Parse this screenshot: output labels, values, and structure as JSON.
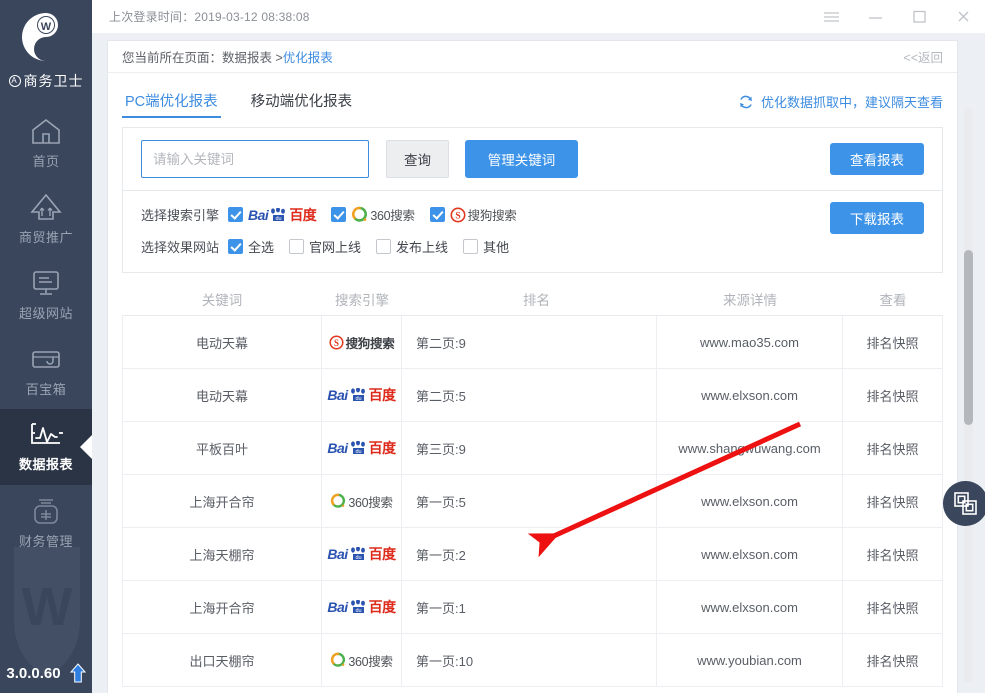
{
  "sidebar": {
    "brand": "商务卫士",
    "brand_mark": "A",
    "items": [
      {
        "label": "首页",
        "icon": "home-icon",
        "active": false
      },
      {
        "label": "商贸推广",
        "icon": "promotion-arrow-icon",
        "active": false
      },
      {
        "label": "超级网站",
        "icon": "monitor-icon",
        "active": false
      },
      {
        "label": "百宝箱",
        "icon": "toolbox-icon",
        "active": false
      },
      {
        "label": "数据报表",
        "icon": "chart-pulse-icon",
        "active": true
      },
      {
        "label": "财务管理",
        "icon": "finance-icon",
        "active": false
      }
    ],
    "version": "3.0.0.60",
    "upgrade_icon": "upgrade-arrow-icon"
  },
  "titlebar": {
    "login_time": "上次登录时间：2019-03-12 08:38:08",
    "menu_icon": "hamburger-menu-icon",
    "minimize_icon": "minimize-icon",
    "maximize_icon": "maximize-icon",
    "close_icon": "close-icon"
  },
  "breadcrumb": {
    "prefix": "您当前所在页面：数据报表 > ",
    "current": "优化报表",
    "back": "<<返回"
  },
  "tabs": [
    {
      "label": "PC端优化报表",
      "active": true
    },
    {
      "label": "移动端优化报表",
      "active": false
    }
  ],
  "fetch_note": {
    "text": "优化数据抓取中，建议隔天查看",
    "icon": "refresh-icon"
  },
  "search": {
    "placeholder": "请输入关键词",
    "value": "",
    "query_label": "查询",
    "manage_label": "管理关键词",
    "view_report_label": "查看报表",
    "download_report_label": "下载报表"
  },
  "engine_filter": {
    "label": "选择搜索引擎",
    "options": [
      {
        "name": "百度",
        "logo": "baidu-logo",
        "checked": true
      },
      {
        "name": "360搜索",
        "logo": "360-logo",
        "checked": true
      },
      {
        "name": "搜狗搜索",
        "logo": "sogou-logo",
        "checked": true
      }
    ]
  },
  "site_filter": {
    "label": "选择效果网站",
    "options": [
      {
        "name": "全选",
        "checked": true
      },
      {
        "name": "官网上线",
        "checked": false
      },
      {
        "name": "发布上线",
        "checked": false
      },
      {
        "name": "其他",
        "checked": false
      }
    ]
  },
  "table": {
    "headers": [
      "关键词",
      "搜索引擎",
      "排名",
      "来源详情",
      "查看"
    ],
    "rows": [
      {
        "keyword": "电动天幕",
        "engine": "sogou",
        "engine_name": "搜狗搜索",
        "rank": "第二页:9",
        "source": "www.mao35.com",
        "view": "排名快照"
      },
      {
        "keyword": "电动天幕",
        "engine": "baidu",
        "engine_name": "百度",
        "rank": "第二页:5",
        "source": "www.elxson.com",
        "view": "排名快照"
      },
      {
        "keyword": "平板百叶",
        "engine": "baidu",
        "engine_name": "百度",
        "rank": "第三页:9",
        "source": "www.shangwuwang.com",
        "view": "排名快照"
      },
      {
        "keyword": "上海开合帘",
        "engine": "s360",
        "engine_name": "360搜索",
        "rank": "第一页:5",
        "source": "www.elxson.com",
        "view": "排名快照"
      },
      {
        "keyword": "上海天棚帘",
        "engine": "baidu",
        "engine_name": "百度",
        "rank": "第一页:2",
        "source": "www.elxson.com",
        "view": "排名快照"
      },
      {
        "keyword": "上海开合帘",
        "engine": "baidu",
        "engine_name": "百度",
        "rank": "第一页:1",
        "source": "www.elxson.com",
        "view": "排名快照"
      },
      {
        "keyword": "出口天棚帘",
        "engine": "s360",
        "engine_name": "360搜索",
        "rank": "第一页:10",
        "source": "www.youbian.com",
        "view": "排名快照"
      }
    ]
  },
  "side_fab": {
    "icon": "window-switch-icon"
  },
  "annotation": {
    "type": "arrow",
    "color": "#ee1111"
  },
  "colors": {
    "sidebar_bg": "#39465c",
    "sidebar_active": "#2b3445",
    "accent_blue": "#3d93e8",
    "link_blue": "#3d8ce0",
    "annotation_red": "#ee1111"
  }
}
